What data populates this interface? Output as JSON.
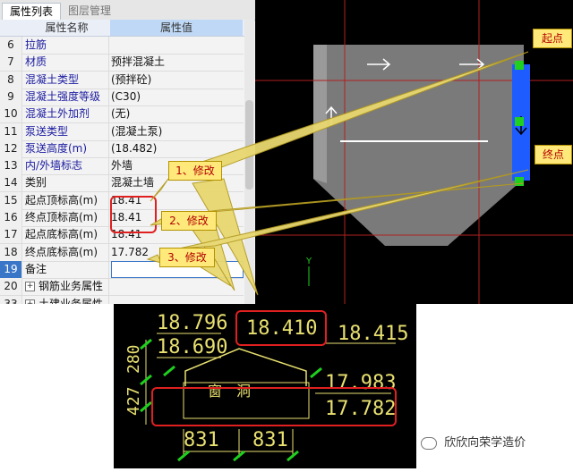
{
  "tabs": [
    "属性列表",
    "图层管理"
  ],
  "table": {
    "header": {
      "name": "属性名称",
      "value": "属性值"
    },
    "rows": [
      {
        "num": "6",
        "name": "拉筋",
        "value": ""
      },
      {
        "num": "7",
        "name": "材质",
        "value": "预拌混凝土"
      },
      {
        "num": "8",
        "name": "混凝土类型",
        "value": "(预拌砼)"
      },
      {
        "num": "9",
        "name": "混凝土强度等级",
        "value": "(C30)"
      },
      {
        "num": "10",
        "name": "混凝土外加剂",
        "value": "(无)"
      },
      {
        "num": "11",
        "name": "泵送类型",
        "value": "(混凝土泵)"
      },
      {
        "num": "12",
        "name": "泵送高度(m)",
        "value": "(18.482)"
      },
      {
        "num": "13",
        "name": "内/外墙标志",
        "value": "外墙"
      },
      {
        "num": "14",
        "name": "类别",
        "value": "混凝土墙"
      },
      {
        "num": "15",
        "name": "起点顶标高(m)",
        "value": "18.41"
      },
      {
        "num": "16",
        "name": "终点顶标高(m)",
        "value": "18.41"
      },
      {
        "num": "17",
        "name": "起点底标高(m)",
        "value": "18.41"
      },
      {
        "num": "18",
        "name": "终点底标高(m)",
        "value": "17.782"
      },
      {
        "num": "19",
        "name": "备注",
        "value": ""
      },
      {
        "num": "20",
        "name": "钢筋业务属性",
        "value": ""
      },
      {
        "num": "33",
        "name": "土建业务属性",
        "value": ""
      }
    ]
  },
  "callouts": {
    "c1": "1、修改",
    "c2": "2、修改",
    "c3": "3、修改",
    "start": "起点",
    "end": "终点"
  },
  "cad": {
    "axis_label": "Y",
    "dims": {
      "a": "18.796",
      "b": "18.690",
      "c": "18.410",
      "d": "18.415",
      "e": "17.983",
      "f": "17.782",
      "g": "427",
      "h": "280",
      "i": "831",
      "j": "831"
    },
    "window_text": "窗　洞"
  },
  "watermark": "欣欣向荣学造价",
  "colors": {
    "cad_bg": "#000000",
    "cad_yellow": "#e8e070",
    "cad_red": "#cc2020",
    "cad_green": "#1fd01f",
    "cad_blue": "#1e5cff",
    "callout_fill": "#ffe97a",
    "highlight_red": "#e02020",
    "link_blue": "#1a1aa0"
  }
}
